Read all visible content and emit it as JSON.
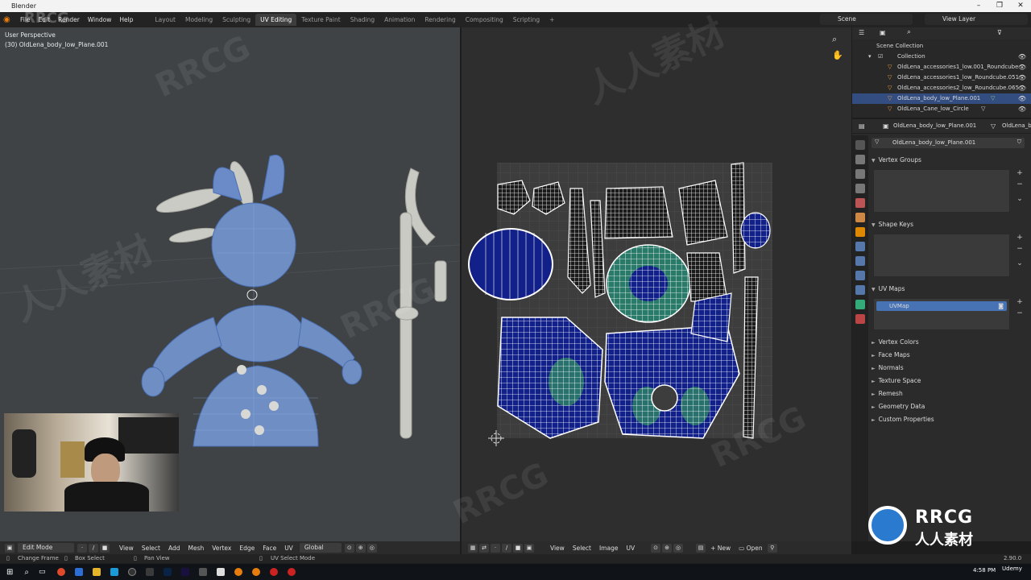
{
  "window": {
    "title": "Blender",
    "controls": [
      "–",
      "❐",
      "✕"
    ]
  },
  "menu": [
    "File",
    "Edit",
    "Render",
    "Window",
    "Help"
  ],
  "workspace_tabs": [
    "Layout",
    "Modeling",
    "Sculpting",
    "UV Editing",
    "Texture Paint",
    "Shading",
    "Animation",
    "Rendering",
    "Compositing",
    "Scripting"
  ],
  "active_workspace": "UV Editing",
  "add_tab": "+",
  "scene": {
    "label": "Scene",
    "view_layer": "View Layer"
  },
  "viewport": {
    "view_name": "User Perspective",
    "object_info": "(30) OldLena_body_low_Plane.001",
    "header": {
      "mode": "Edit Mode",
      "menus": [
        "View",
        "Select",
        "Add",
        "Mesh",
        "Vertex",
        "Edge",
        "Face",
        "UV"
      ],
      "transform": "Global"
    }
  },
  "uv_editor": {
    "header": {
      "menus": [
        "View",
        "Select",
        "Image",
        "UV"
      ],
      "new_label": "New",
      "open_label": "Open"
    }
  },
  "outliner": {
    "root": "Scene Collection",
    "collection": "Collection",
    "items": [
      "OldLena_accessories1_low.001_Roundcube",
      "OldLena_accessories1_low_Roundcube.051",
      "OldLena_accessories2_low_Roundcube.065",
      "OldLena_body_low_Plane.001",
      "OldLena_Cane_low_Circle"
    ],
    "selected_index": 3
  },
  "properties": {
    "breadcrumb": "OldLena_body_low_Plane.001",
    "breadcrumb_mesh": "OldLena_b",
    "mesh_name": "OldLena_body_low_Plane.001",
    "panels": {
      "vertex_groups": "Vertex Groups",
      "shape_keys": "Shape Keys",
      "uv_maps": "UV Maps",
      "uv_map_item": "UVMap",
      "collapsed": [
        "Vertex Colors",
        "Face Maps",
        "Normals",
        "Texture Space",
        "Remesh",
        "Geometry Data",
        "Custom Properties"
      ]
    }
  },
  "status": {
    "change_frame": "Change Frame",
    "box_select": "Box Select",
    "pan_view": "Pan View",
    "uv_select_mode": "UV Select Mode",
    "version": "2.90.0"
  },
  "taskbar": {
    "time": "4:58 PM",
    "date": "Udemy"
  },
  "watermark": {
    "brand": "RRCG",
    "cn": "人人素材"
  },
  "colors": {
    "accent": "#4772b3",
    "uv_island": "#1a2a8a",
    "selection": "#334d80"
  }
}
